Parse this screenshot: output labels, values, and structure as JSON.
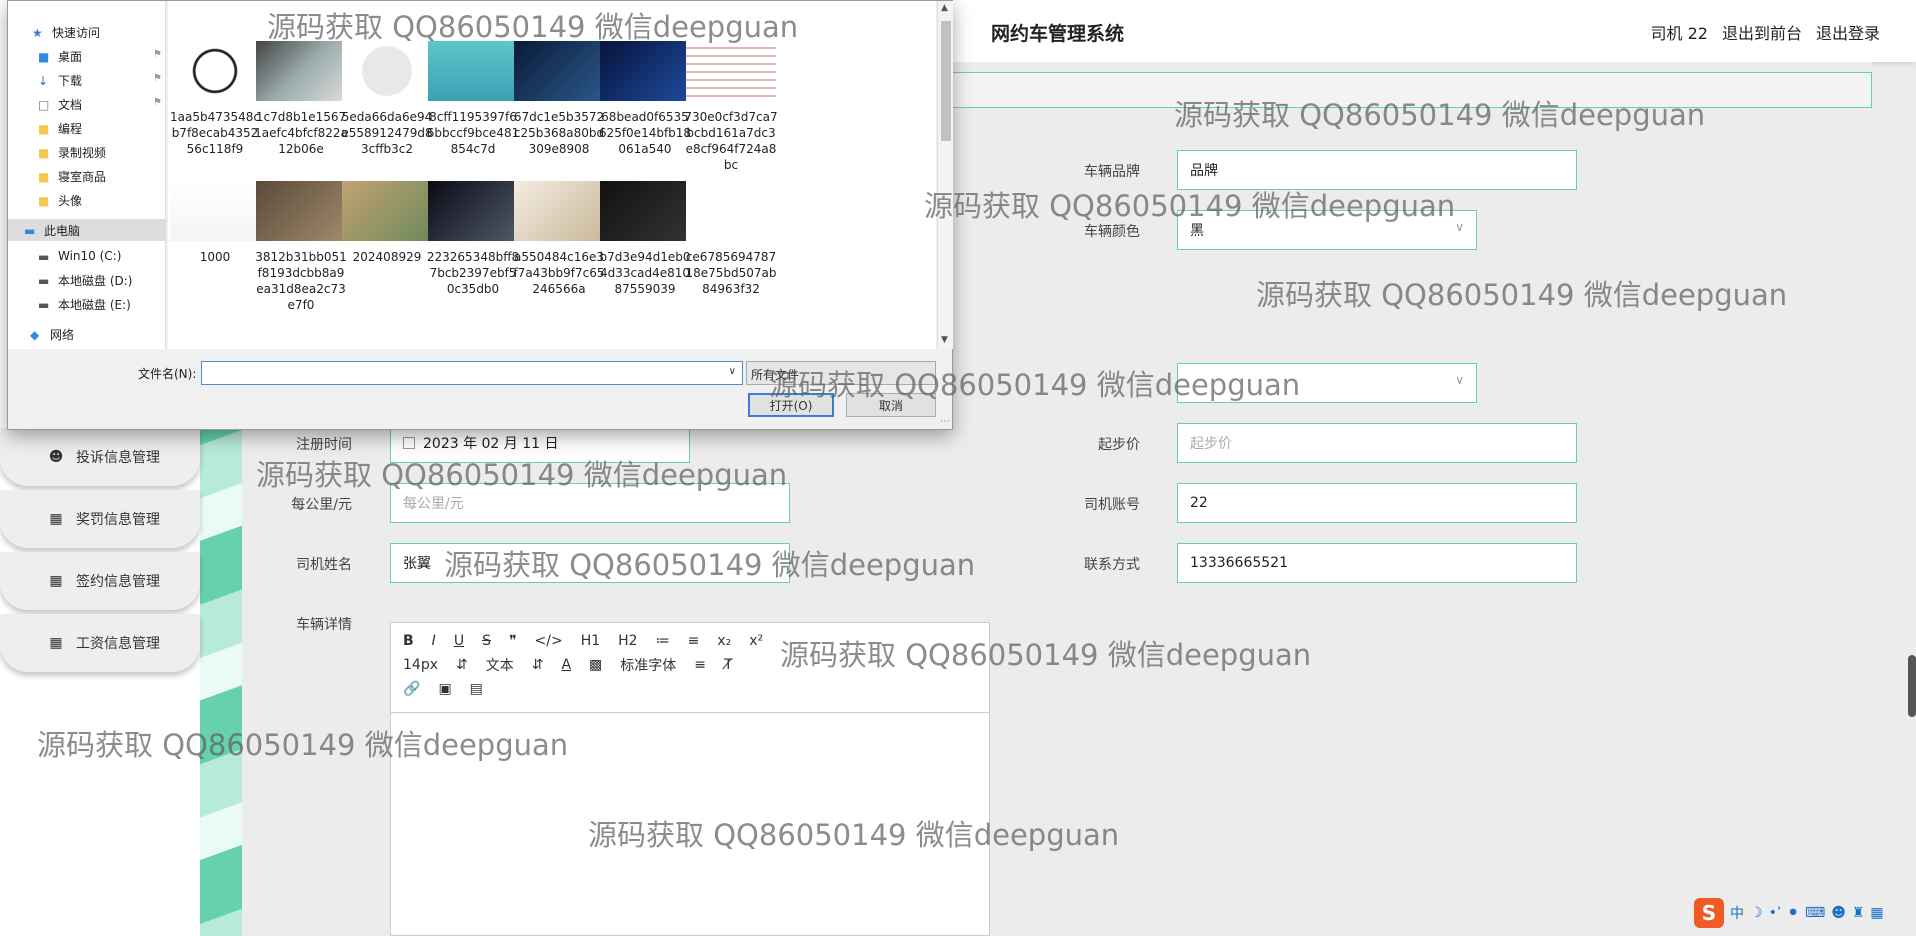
{
  "header": {
    "title": "网约车管理系统",
    "user": "司机 22",
    "to_front": "退出到前台",
    "logout": "退出登录"
  },
  "sidebar": {
    "items": [
      {
        "label": "投诉信息管理",
        "icon": "user-icon"
      },
      {
        "label": "奖罚信息管理",
        "icon": "grid-icon"
      },
      {
        "label": "签约信息管理",
        "icon": "grid-icon"
      },
      {
        "label": "工资信息管理",
        "icon": "grid-icon"
      }
    ]
  },
  "form": {
    "brand": {
      "label": "车辆品牌",
      "value": "品牌"
    },
    "color": {
      "label": "车辆颜色",
      "value": "黑"
    },
    "reg_time": {
      "label": "注册时间",
      "value": "2023 年 02 月 11 日"
    },
    "start_price": {
      "label": "起步价",
      "placeholder": "起步价"
    },
    "per_km": {
      "label": "每公里/元",
      "placeholder": "每公里/元"
    },
    "driver_account": {
      "label": "司机账号",
      "value": "22"
    },
    "driver_name": {
      "label": "司机姓名",
      "value": "张翼"
    },
    "contact": {
      "label": "联系方式",
      "value": "13336665521"
    },
    "details": {
      "label": "车辆详情"
    }
  },
  "editor": {
    "row1": [
      "B",
      "I",
      "U",
      "S",
      "❞",
      "</>",
      "H1",
      "H2",
      "≔",
      "≡",
      "x₂",
      "x²"
    ],
    "font_size": "14px",
    "text_type": "文本",
    "font_family": "标准字体"
  },
  "dialog": {
    "nav": [
      {
        "label": "快速访问",
        "icon": "star-icon"
      },
      {
        "label": "桌面",
        "icon": "desktop-icon"
      },
      {
        "label": "下载",
        "icon": "download-icon"
      },
      {
        "label": "文档",
        "icon": "document-icon"
      },
      {
        "label": "编程",
        "icon": "folder-icon"
      },
      {
        "label": "录制视频",
        "icon": "folder-icon"
      },
      {
        "label": "寝室商品",
        "icon": "folder-icon"
      },
      {
        "label": "头像",
        "icon": "folder-icon"
      },
      {
        "label": "此电脑",
        "icon": "computer-icon"
      },
      {
        "label": "Win10 (C:)",
        "icon": "drive-icon"
      },
      {
        "label": "本地磁盘 (D:)",
        "icon": "drive-icon"
      },
      {
        "label": "本地磁盘 (E:)",
        "icon": "drive-icon"
      },
      {
        "label": "网络",
        "icon": "network-icon"
      }
    ],
    "files": [
      "1aa5b473548cb7f8ecab435256c118f9",
      "1c7d8b1e15671aefc4bfcf822a12b06e",
      "5eda66da6e94e558912479d83cffb3c2",
      "8cff1195397f66bbccf9bce481854c7d",
      "67dc1e5b3572c25b368a80bd309e8908",
      "68bead0f6535625f0e14bfb18061a540",
      "730e0cf3d7ca7bcbd161a7dc3e8cf964f724a8bc",
      "1000",
      "3812b31bb051f8193dcbb8a9ea31d8ea2c73e7f0",
      "202408929",
      "223265348bff87bcb2397ebf50c35db0",
      "a550484c16e3f7a43bb9f7c65246566a",
      "b7d3e94d1eb04d33cad4e81087559039",
      "ce678569478718e75bd507ab84963f32"
    ],
    "filename_label": "文件名(N):",
    "filename_value": "",
    "filetype": "所有文件",
    "open_label": "打开(O)",
    "cancel_label": "取消"
  },
  "watermark": "源码获取 QQ86050149 微信deepguan",
  "ime": {
    "lang": "中"
  }
}
